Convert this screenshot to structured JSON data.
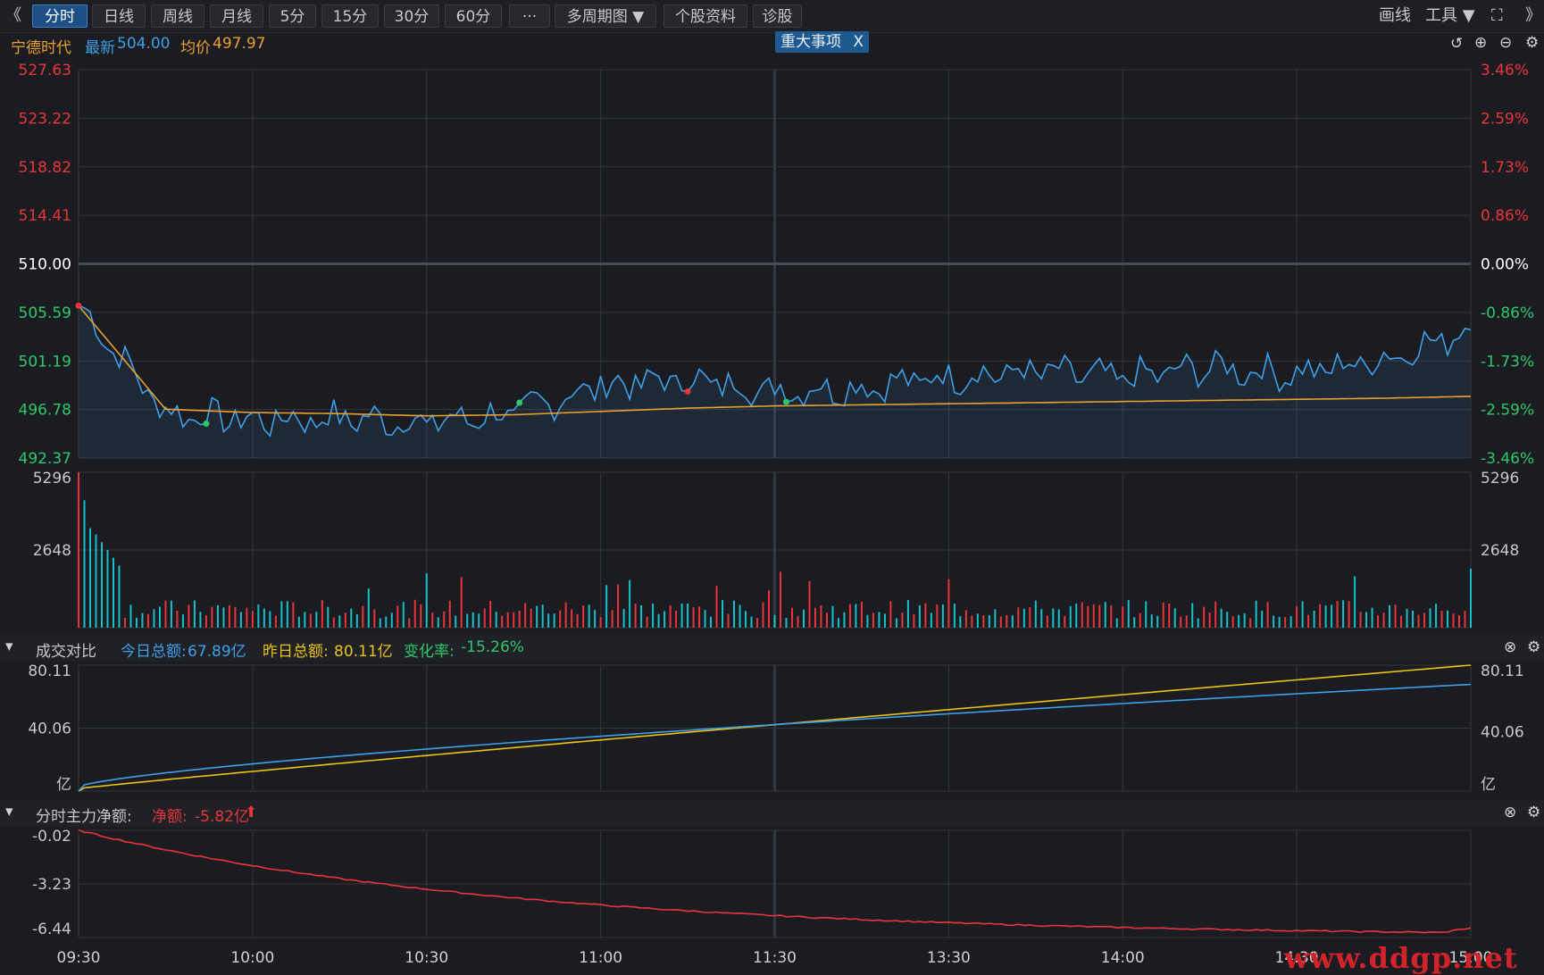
{
  "toolbar": {
    "collapse": "《",
    "tabs": [
      "分时",
      "日线",
      "周线",
      "月线",
      "5分",
      "15分",
      "30分",
      "60分",
      "···",
      "多周期图 ▼",
      "个股资料",
      "诊股"
    ],
    "active_tab": "分时",
    "draw": "画线",
    "tools": "工具 ▼",
    "expand": "《"
  },
  "stock": {
    "name": "宁德时代",
    "latest_label": "最新",
    "latest": "504.00",
    "avg_label": "均价",
    "avg": "497.97"
  },
  "event_tag": {
    "label": "重大事项",
    "close": "X"
  },
  "price_axis": {
    "left": [
      "527.63",
      "523.22",
      "518.82",
      "514.41",
      "510.00",
      "505.59",
      "501.19",
      "496.78",
      "492.37"
    ],
    "right": [
      "3.46%",
      "2.59%",
      "1.73%",
      "0.86%",
      "0.00%",
      "-0.86%",
      "-1.73%",
      "-2.59%",
      "-3.46%"
    ]
  },
  "volume_axis": {
    "left": [
      "5296",
      "2648"
    ],
    "right": [
      "5296",
      "2648"
    ]
  },
  "compare": {
    "title": "成交对比",
    "today_label": "今日总额:",
    "today": "67.89亿",
    "yesterday_label": "昨日总额:",
    "yesterday": "80.11亿",
    "change_label": "变化率:",
    "change": "-15.26%",
    "axis": [
      "80.11",
      "40.06",
      "亿"
    ]
  },
  "netflow": {
    "title": "分时主力净额:",
    "value_label": "净额:",
    "value": "-5.82亿",
    "arrow": "⬆",
    "axis": [
      "-0.02",
      "-3.23",
      "-6.44"
    ]
  },
  "time_axis": [
    "09:30",
    "10:00",
    "10:30",
    "11:00",
    "11:30",
    "13:30",
    "14:00",
    "14:30",
    "15:00"
  ],
  "watermark": "www.ddgp.net",
  "colors": {
    "price": "#3ea0e8",
    "avg": "#e8a030",
    "up": "#e8353a",
    "down": "#16c0c8",
    "yesterday": "#e8c410",
    "netflow": "#e8353a"
  },
  "chart_data": {
    "type": "line",
    "title": "宁德时代",
    "time": [
      "09:30",
      "09:45",
      "10:00",
      "10:15",
      "10:30",
      "10:45",
      "11:00",
      "11:15",
      "11:30",
      "13:15",
      "13:30",
      "13:45",
      "14:00",
      "14:15",
      "14:30",
      "14:45",
      "15:00"
    ],
    "series": [
      {
        "name": "最新",
        "values": [
          506.2,
          496.5,
          495.8,
          496.0,
          495.6,
          496.4,
          499.0,
          499.5,
          498.5,
          498.8,
          499.8,
          500.2,
          499.6,
          500.6,
          500.0,
          501.4,
          504.0
        ]
      },
      {
        "name": "均价",
        "values": [
          506.2,
          496.8,
          496.5,
          496.4,
          496.2,
          496.3,
          496.6,
          496.9,
          497.1,
          497.2,
          497.3,
          497.4,
          497.5,
          497.6,
          497.7,
          497.8,
          497.97
        ]
      }
    ],
    "ylim": [
      492.37,
      527.63
    ],
    "reference": 510.0,
    "volume_max": 5296,
    "compare_series": [
      {
        "name": "今日总额",
        "end": 67.89
      },
      {
        "name": "昨日总额",
        "end": 80.11
      }
    ],
    "netflow_range": [
      -6.44,
      -0.02
    ]
  }
}
